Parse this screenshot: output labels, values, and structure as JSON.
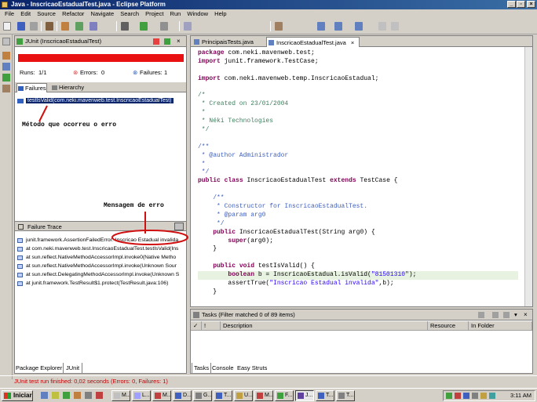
{
  "window": {
    "title": "Java - InscricaoEstadualTest.java - Eclipse Platform"
  },
  "menu": [
    "File",
    "Edit",
    "Source",
    "Refactor",
    "Navigate",
    "Search",
    "Project",
    "Run",
    "Window",
    "Help"
  ],
  "junit": {
    "view_title": "JUnit (InscricaoEstadualTest)",
    "runs_label": "Runs:",
    "runs_value": "1/1",
    "errors_label": "Errors:",
    "errors_value": "0",
    "failures_label": "Failures:",
    "failures_value": "1",
    "tab_failures": "Failures",
    "tab_hierarchy": "Hierarchy",
    "failed_test": "testIsValid(com.neki.mavenweb.test.InscricaoEstadualTest)",
    "failure_trace_title": "Failure Trace",
    "trace": [
      "junit.framework.AssertionFailedError: Inscricao Estadual invalida",
      "at com.neki.mavenweb.test.InscricaoEstadualTest.testIsValid(Ins",
      "at sun.reflect.NativeMethodAccessorImpl.invoke0(Native Metho",
      "at sun.reflect.NativeMethodAccessorImpl.invoke(Unknown Sour",
      "at sun.reflect.DelegatingMethodAccessorImpl.invoke(Unknown S",
      "at junit.framework.TestResult$1.protect(TestResult.java:106)"
    ],
    "bottom_tabs": [
      "Package Explorer",
      "JUnit"
    ]
  },
  "annotations": {
    "method": "Método que ocorreu o erro",
    "message": "Mensagem de erro"
  },
  "editor": {
    "tabs": [
      "PrincipaisTests.java",
      "InscricaoEstadualTest.java"
    ],
    "code": [
      "package com.neki.mavenweb.test;",
      "import junit.framework.TestCase;",
      "",
      "import com.neki.mavenweb.temp.InscricaoEstadual;",
      "",
      "/*",
      " * Created on 23/01/2004",
      " *",
      " * Néki Technologies",
      " */",
      "",
      "/**",
      " * @author Administrador",
      " *",
      " */",
      "public class InscricaoEstadualTest extends TestCase {",
      "",
      "    /**",
      "     * Constructor for InscricaoEstadualTest.",
      "     * @param arg0",
      "     */",
      "    public InscricaoEstadualTest(String arg0) {",
      "        super(arg0);",
      "    }",
      "",
      "    public void testIsValid() {",
      "        boolean b = InscricaoEstadual.isValid(\"81501310\");",
      "        assertTrue(\"Inscricao Estadual invalida\",b);",
      "    }"
    ]
  },
  "tasks": {
    "title": "Tasks (Filter matched 0 of 89 items)",
    "columns": [
      "✓",
      "!",
      "Description",
      "Resource",
      "In Folder"
    ],
    "bottom_tabs": [
      "Tasks",
      "Console",
      "Easy Struts"
    ]
  },
  "status": "JUnit test run finished: 0,02 seconds (Errors: 0, Failures: 1)",
  "taskbar": {
    "start": "Iniciar",
    "tasks": [
      "M...",
      "L...",
      "M...",
      "D...",
      "G...",
      "T...",
      "U...",
      "M...",
      "F...",
      "J...",
      "T...",
      "T..."
    ],
    "clock": "3:11 AM"
  }
}
